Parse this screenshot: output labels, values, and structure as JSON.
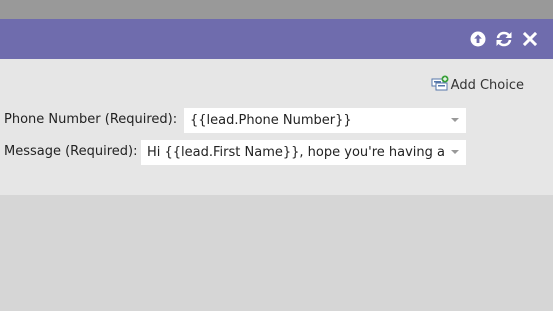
{
  "colors": {
    "header": "#6f6cad",
    "panel": "#e6e6e6",
    "backdrop": "#d6d6d6"
  },
  "header": {
    "icons": [
      "arrow-up-circle-icon",
      "refresh-icon",
      "close-icon"
    ]
  },
  "toolbar": {
    "add_choice_label": "Add Choice",
    "add_choice_icon": "add-choice-icon"
  },
  "fields": {
    "phone": {
      "label": "Phone Number (Required):",
      "value": "{{lead.Phone Number}}"
    },
    "message": {
      "label": "Message (Required):",
      "value": "Hi {{lead.First Name}}, hope you're having a g"
    }
  }
}
